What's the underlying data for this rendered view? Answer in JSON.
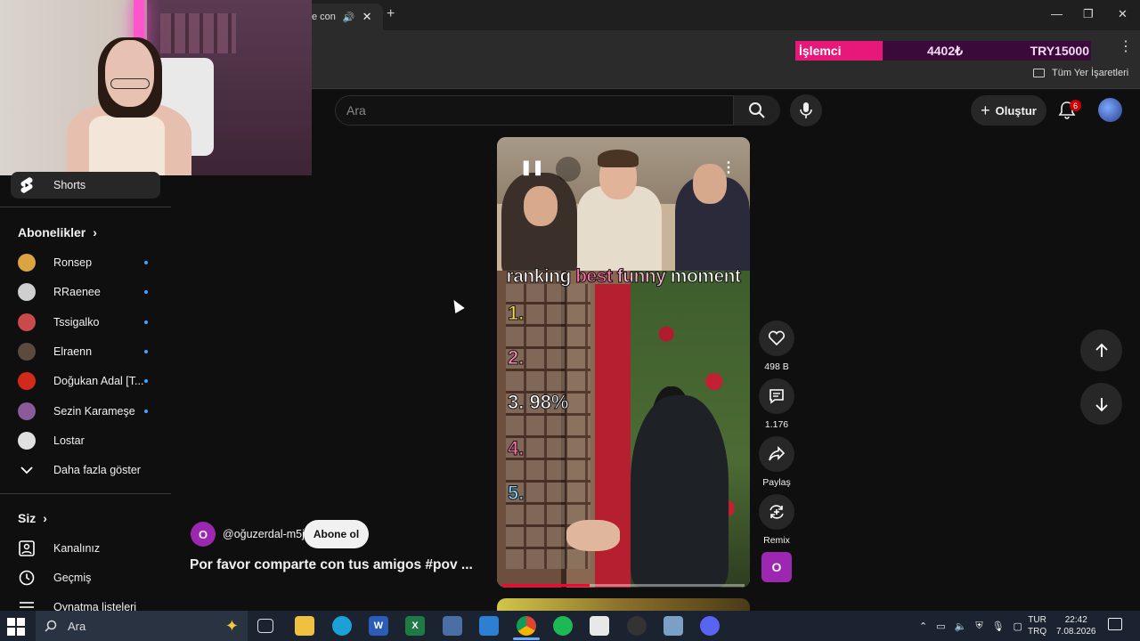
{
  "browser": {
    "tab_title": "e con",
    "new_tab": "+",
    "window_controls": [
      "—",
      "❐",
      "✕"
    ],
    "cpu_widget": {
      "label": "İşlemci",
      "mhz": "4402₺",
      "try": "TRY15000"
    },
    "bookmarks_all": "Tüm Yer İşaretleri"
  },
  "header": {
    "search_placeholder": "Ara",
    "create_label": "Oluştur",
    "notifications_count": "6"
  },
  "sidebar": {
    "shorts_label": "Shorts",
    "subscriptions_title": "Abonelikler",
    "subscriptions": [
      {
        "name": "Ronsep",
        "color": "#d9a441"
      },
      {
        "name": "RRaenee",
        "color": "#cfcfcf"
      },
      {
        "name": "Tssigalko",
        "color": "#c94a4a"
      },
      {
        "name": "Elraenn",
        "color": "#5a4a40"
      },
      {
        "name": "Doğukan Adal [T...",
        "color": "#d12a1a"
      },
      {
        "name": "Sezin Karameşe",
        "color": "#8a5a9a"
      },
      {
        "name": "Lostar",
        "color": "#e0e0e0"
      }
    ],
    "show_more": "Daha fazla göster",
    "you_title": "Siz",
    "you_items": [
      "Kanalınız",
      "Geçmiş",
      "Oynatma listeleri"
    ]
  },
  "short": {
    "caption": [
      "ranking",
      "best",
      "funny",
      "moment"
    ],
    "caption_colors": [
      "#ffffff",
      "#ff6fa8",
      "#ffb3d1",
      "#ffffff"
    ],
    "ranks": [
      {
        "text": "1.",
        "color": "#f5e04a"
      },
      {
        "text": "2.",
        "color": "#ff8fb0"
      },
      {
        "text": "3. 98%",
        "color": "#ffffff"
      },
      {
        "text": "4.",
        "color": "#ff6fa8"
      },
      {
        "text": "5.",
        "color": "#7fd3ff"
      }
    ],
    "progress": 0.36,
    "likes": "498 B",
    "comments": "1.176",
    "share": "Paylaş",
    "remix": "Remix",
    "channel_initial": "O",
    "channel_handle": "@oğuzerdal-m5j",
    "subscribe_label": "Abone ol",
    "title": "Por favor comparte con tus amigos #pov ..."
  },
  "taskbar": {
    "search_placeholder": "Ara",
    "lang_top": "TUR",
    "lang_bottom": "TRQ",
    "time": "22:42",
    "date": "7.08.2026"
  }
}
